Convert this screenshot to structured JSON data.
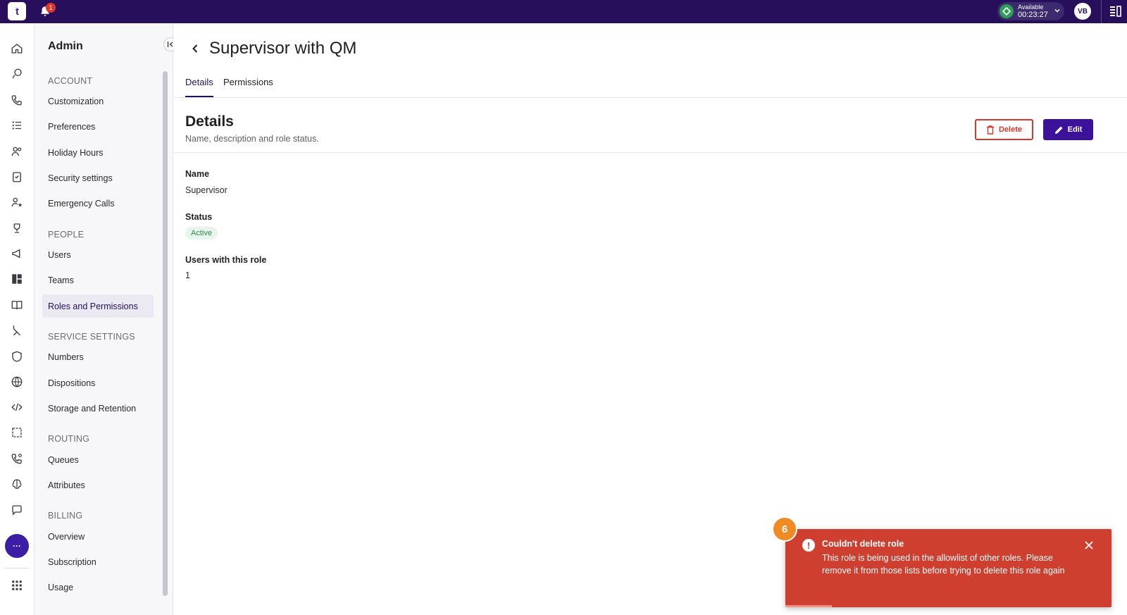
{
  "topbar": {
    "logo_text": "t",
    "notification_count": "1",
    "status": {
      "label": "Available",
      "timer": "00:23:27",
      "color": "#2e9e57"
    },
    "avatar_initials": "VB",
    "brand_color": "#270f5c"
  },
  "rail": {
    "icons": [
      "home-icon",
      "chat-icon",
      "phone-icon",
      "list-icon",
      "people-icon",
      "clipboard-icon",
      "person-star-icon",
      "trophy-icon",
      "megaphone-icon",
      "dashboard-icon",
      "book-icon",
      "flow-icon",
      "shield-icon",
      "globe-icon",
      "code-icon",
      "frame-icon",
      "call-settings-icon",
      "brain-icon",
      "message-icon"
    ],
    "more_label": "···",
    "apps_icon": "grid-icon"
  },
  "sidebar": {
    "title": "Admin",
    "sections": [
      {
        "heading": "ACCOUNT",
        "items": [
          "Customization",
          "Preferences",
          "Holiday Hours",
          "Security settings",
          "Emergency Calls"
        ]
      },
      {
        "heading": "PEOPLE",
        "items": [
          "Users",
          "Teams",
          "Roles and Permissions"
        ]
      },
      {
        "heading": "SERVICE SETTINGS",
        "items": [
          "Numbers",
          "Dispositions",
          "Storage and Retention"
        ]
      },
      {
        "heading": "ROUTING",
        "items": [
          "Queues",
          "Attributes"
        ]
      },
      {
        "heading": "BILLING",
        "items": [
          "Overview",
          "Subscription",
          "Usage"
        ]
      }
    ],
    "active_item": "Roles and Permissions"
  },
  "main": {
    "title": "Supervisor with QM",
    "tabs": [
      {
        "label": "Details",
        "active": true
      },
      {
        "label": "Permissions",
        "active": false
      }
    ],
    "details": {
      "heading": "Details",
      "subheading": "Name, description and role status.",
      "delete_label": "Delete",
      "edit_label": "Edit",
      "fields": {
        "name_label": "Name",
        "name_value": "Supervisor",
        "status_label": "Status",
        "status_value": "Active",
        "users_label": "Users with this role",
        "users_value": "1"
      }
    }
  },
  "toast": {
    "title": "Couldn't delete role",
    "message": "This role is being used in the allowlist of other roles. Please remove it from those lists before trying to delete this role again",
    "color": "#cf3f2f",
    "step_badge": "6"
  }
}
